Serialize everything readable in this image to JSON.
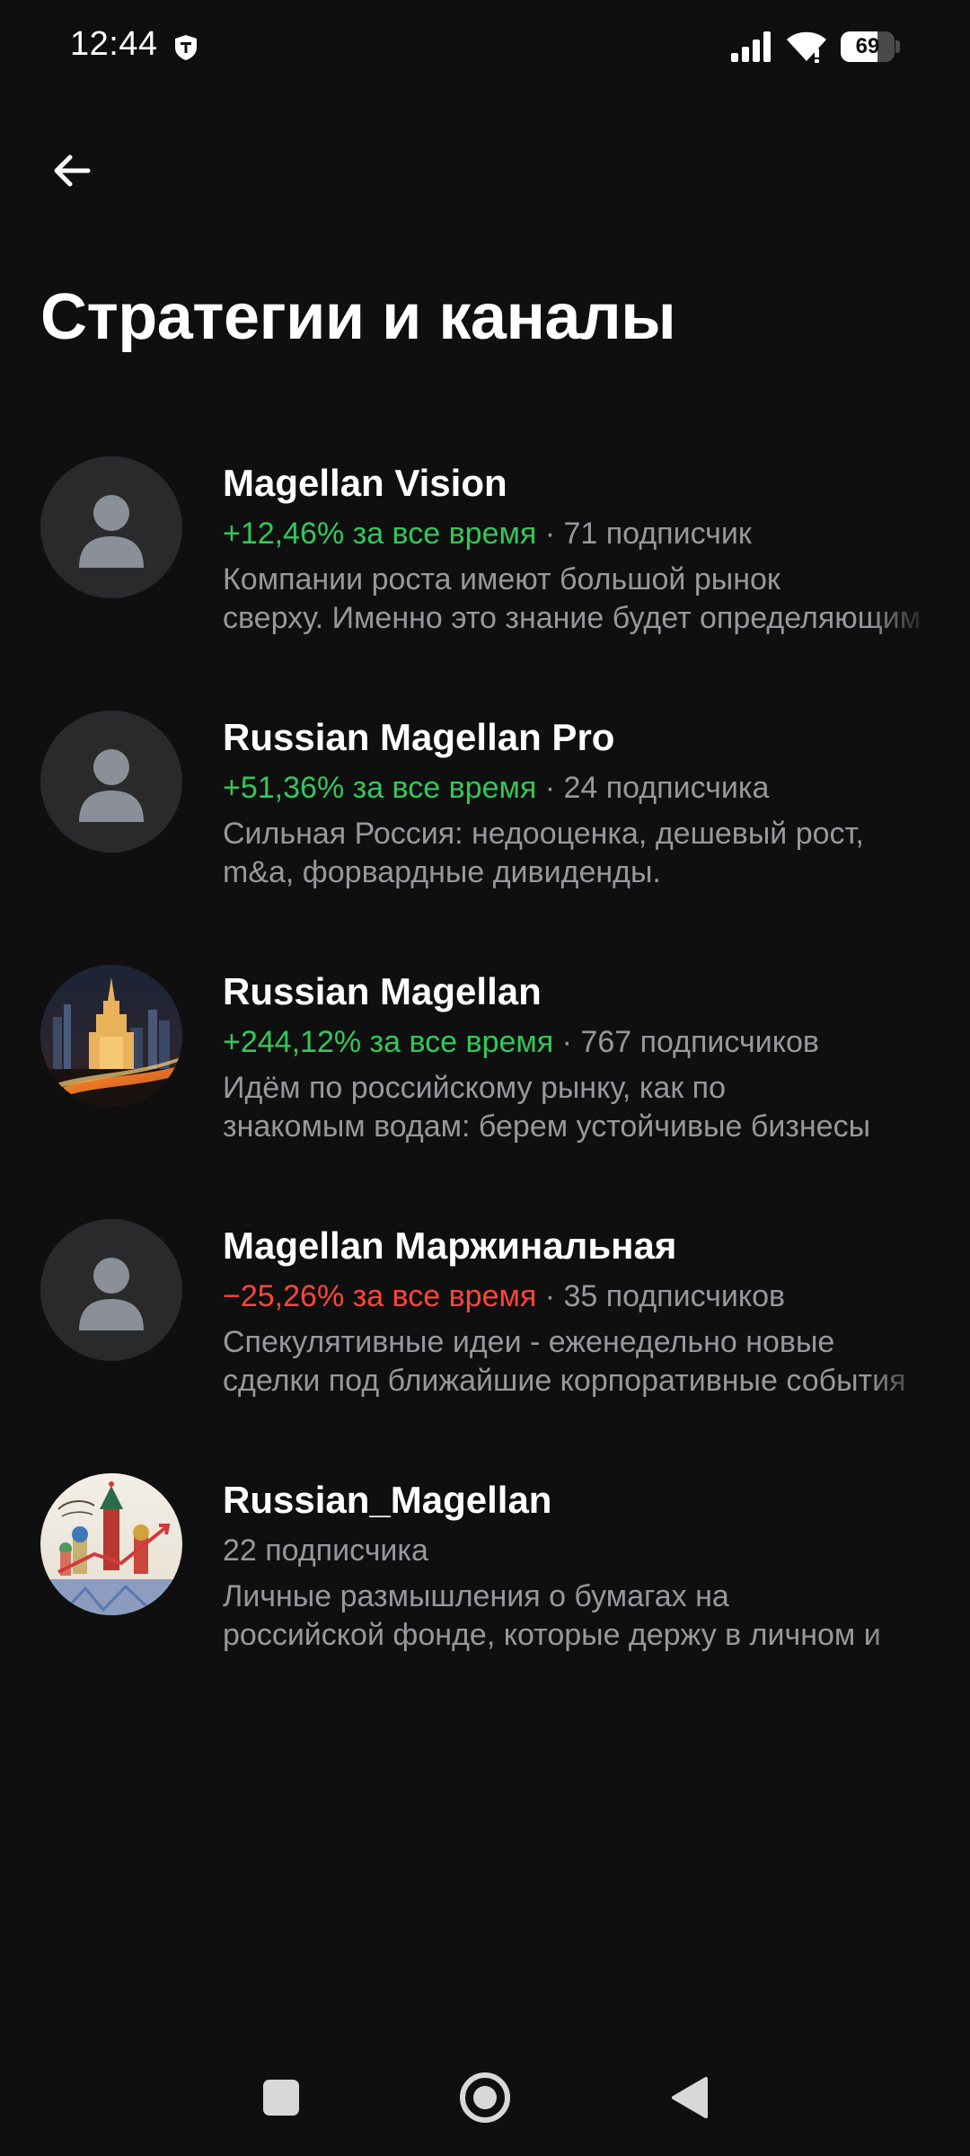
{
  "status_bar": {
    "time": "12:44",
    "battery_level": "69",
    "battery_fraction": 0.69
  },
  "header": {
    "title": "Стратегии и каналы",
    "back_icon": "arrow-left-icon"
  },
  "colors": {
    "background": "#0f0f10",
    "positive": "#34c759",
    "negative": "#ff453a",
    "secondary_text": "#97989c",
    "avatar_placeholder": "#2a2a2d"
  },
  "channels": [
    {
      "name": "Magellan Vision",
      "yield": "+12,46% за все время",
      "yield_sign": "positive",
      "separator": " · ",
      "subscribers": "71 подписчик",
      "desc_line1": "Компании роста имеют большой рынок",
      "desc_line2": "сверху. Именно это знание будет определяющим",
      "avatar": "person-placeholder-icon"
    },
    {
      "name": "Russian Magellan Pro",
      "yield": "+51,36% за все время",
      "yield_sign": "positive",
      "separator": " · ",
      "subscribers": "24 подписчика",
      "desc_line1": "Сильная Россия: недооценка, дешевый рост,",
      "desc_line2": "m&a, форвардные дивиденды.",
      "avatar": "person-placeholder-icon"
    },
    {
      "name": "Russian Magellan",
      "yield": "+244,12% за все время",
      "yield_sign": "positive",
      "separator": " · ",
      "subscribers": "767 подписчиков",
      "desc_line1": "Идём по российскому рынку, как по",
      "desc_line2": "знакомым водам: берем устойчивые бизнесы",
      "avatar": "moscow-night-photo"
    },
    {
      "name": "Magellan Маржинальная",
      "yield": "−25,26% за все время",
      "yield_sign": "negative",
      "separator": " · ",
      "subscribers": "35 подписчиков",
      "desc_line1": "Спекулятивные идеи - еженедельно новые",
      "desc_line2": "сделки под ближайшие корпоративные события",
      "avatar": "person-placeholder-icon"
    },
    {
      "name": "Russian_Magellan",
      "subscribers": "22 подписчика",
      "desc_line1": "Личные размышления о бумагах на",
      "desc_line2": "российской фонде, которые держу в личном и",
      "avatar": "kremlin-painting-image"
    }
  ],
  "nav_bar": {
    "recents_icon": "square-icon",
    "home_icon": "circle-home-icon",
    "back_icon": "triangle-back-icon"
  }
}
